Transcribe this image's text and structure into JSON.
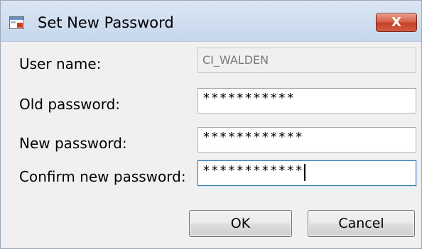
{
  "window": {
    "title": "Set New Password",
    "close_label": "X"
  },
  "form": {
    "user_name": {
      "label": "User name:",
      "value": "CI_WALDEN"
    },
    "old_password": {
      "label": "Old password:",
      "value": "***********"
    },
    "new_password": {
      "label": "New password:",
      "value": "************"
    },
    "confirm_password": {
      "label": "Confirm new password:",
      "value": "************"
    }
  },
  "buttons": {
    "ok_label": "OK",
    "cancel_label": "Cancel"
  }
}
